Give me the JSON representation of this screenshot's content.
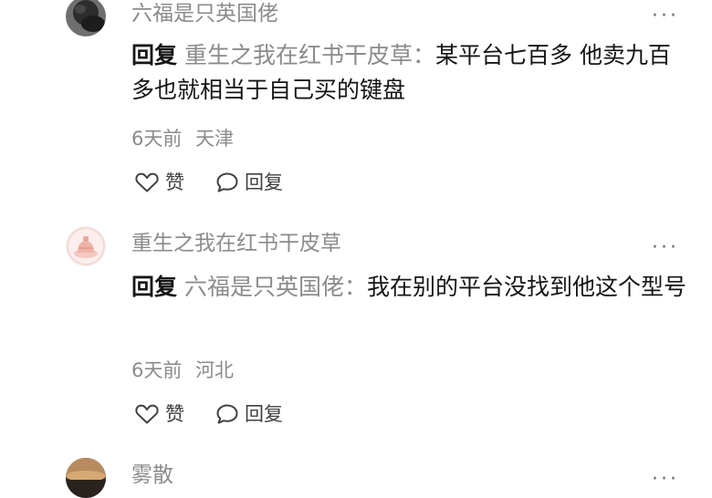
{
  "comments": [
    {
      "username": "六福是只英国佬",
      "reply_prefix": "回复",
      "reply_target": "重生之我在红书干皮草",
      "separator": "：",
      "text": "某平台七百多 他卖九百多也就相当于自己买的键盘",
      "time": "6天前",
      "location": "天津",
      "like_label": "赞",
      "reply_label": "回复",
      "more_label": "···"
    },
    {
      "username": "重生之我在红书干皮草",
      "reply_prefix": "回复",
      "reply_target": "六福是只英国佬",
      "separator": "：",
      "text": "我在别的平台没找到他这个型号",
      "time": "6天前",
      "location": "河北",
      "like_label": "赞",
      "reply_label": "回复",
      "more_label": "···"
    },
    {
      "username": "雾散",
      "more_label": "···"
    }
  ],
  "colors": {
    "secondary_text": "#8b8b8b",
    "primary_text": "#151515"
  },
  "icons": {
    "like": "heart-outline-icon",
    "reply": "speech-bubble-icon",
    "more": "more-dots-icon"
  }
}
